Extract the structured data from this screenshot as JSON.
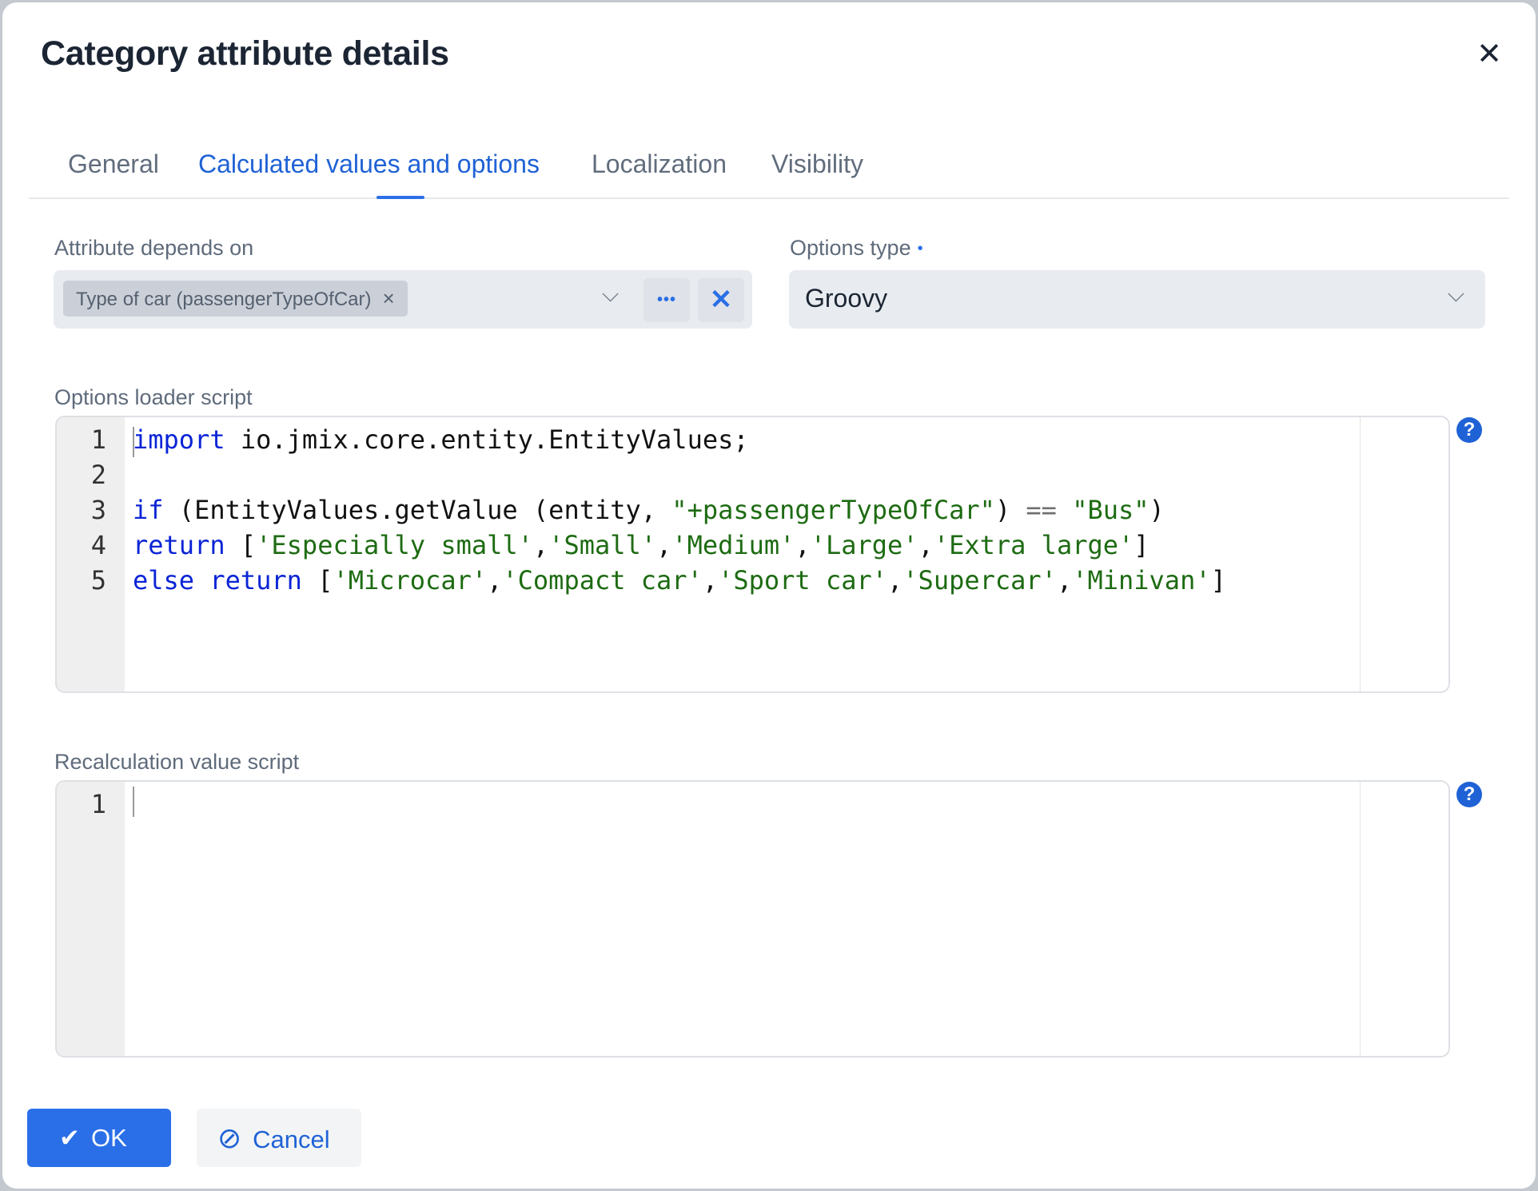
{
  "dialog": {
    "title": "Category attribute details",
    "close_icon": "close-icon"
  },
  "tabs": [
    {
      "label": "General",
      "active": false
    },
    {
      "label": "Calculated values and options",
      "active": true
    },
    {
      "label": "Localization",
      "active": false
    },
    {
      "label": "Visibility",
      "active": false
    }
  ],
  "attribute_depends_on": {
    "label": "Attribute depends on",
    "chips": [
      {
        "label": "Type of car (passengerTypeOfCar)",
        "remove_icon": "×"
      }
    ],
    "dropdown_icon": "⌄",
    "more_icon": "•••",
    "clear_icon": "✕"
  },
  "options_type": {
    "label": "Options type",
    "required": true,
    "required_marker": "•",
    "value": "Groovy",
    "dropdown_icon": "⌄"
  },
  "options_loader_script": {
    "label": "Options loader script",
    "help_icon": "?",
    "lines": [
      {
        "num": "1",
        "tokens": [
          {
            "t": "import",
            "c": "kw"
          },
          {
            "t": " io.jmix.core.entity.EntityValues;",
            "c": ""
          }
        ]
      },
      {
        "num": "2",
        "tokens": []
      },
      {
        "num": "3",
        "tokens": [
          {
            "t": "if",
            "c": "kw"
          },
          {
            "t": " (EntityValues.getValue (entity, ",
            "c": ""
          },
          {
            "t": "\"+passengerTypeOfCar\"",
            "c": "str"
          },
          {
            "t": ") ",
            "c": ""
          },
          {
            "t": "==",
            "c": "op"
          },
          {
            "t": " ",
            "c": ""
          },
          {
            "t": "\"Bus\"",
            "c": "str"
          },
          {
            "t": ")",
            "c": ""
          }
        ]
      },
      {
        "num": "4",
        "tokens": [
          {
            "t": "return",
            "c": "kw"
          },
          {
            "t": " [",
            "c": ""
          },
          {
            "t": "'Especially small'",
            "c": "str"
          },
          {
            "t": ",",
            "c": ""
          },
          {
            "t": "'Small'",
            "c": "str"
          },
          {
            "t": ",",
            "c": ""
          },
          {
            "t": "'Medium'",
            "c": "str"
          },
          {
            "t": ",",
            "c": ""
          },
          {
            "t": "'Large'",
            "c": "str"
          },
          {
            "t": ",",
            "c": ""
          },
          {
            "t": "'Extra large'",
            "c": "str"
          },
          {
            "t": "]",
            "c": ""
          }
        ]
      },
      {
        "num": "5",
        "tokens": [
          {
            "t": "else",
            "c": "kw"
          },
          {
            "t": " ",
            "c": ""
          },
          {
            "t": "return",
            "c": "kw"
          },
          {
            "t": " [",
            "c": ""
          },
          {
            "t": "'Microcar'",
            "c": "str"
          },
          {
            "t": ",",
            "c": ""
          },
          {
            "t": "'Compact car'",
            "c": "str"
          },
          {
            "t": ",",
            "c": ""
          },
          {
            "t": "'Sport car'",
            "c": "str"
          },
          {
            "t": ",",
            "c": ""
          },
          {
            "t": "'Supercar'",
            "c": "str"
          },
          {
            "t": ",",
            "c": ""
          },
          {
            "t": "'Minivan'",
            "c": "str"
          },
          {
            "t": "]",
            "c": ""
          }
        ]
      }
    ]
  },
  "recalculation_value_script": {
    "label": "Recalculation value script",
    "help_icon": "?",
    "lines": [
      {
        "num": "1",
        "tokens": []
      }
    ]
  },
  "buttons": {
    "ok": {
      "label": "OK",
      "icon": "✔"
    },
    "cancel": {
      "label": "Cancel",
      "icon": "⊘"
    }
  },
  "colors": {
    "accent": "#2a6fe8",
    "keyword": "#0a24d6",
    "string": "#1d6b12"
  }
}
